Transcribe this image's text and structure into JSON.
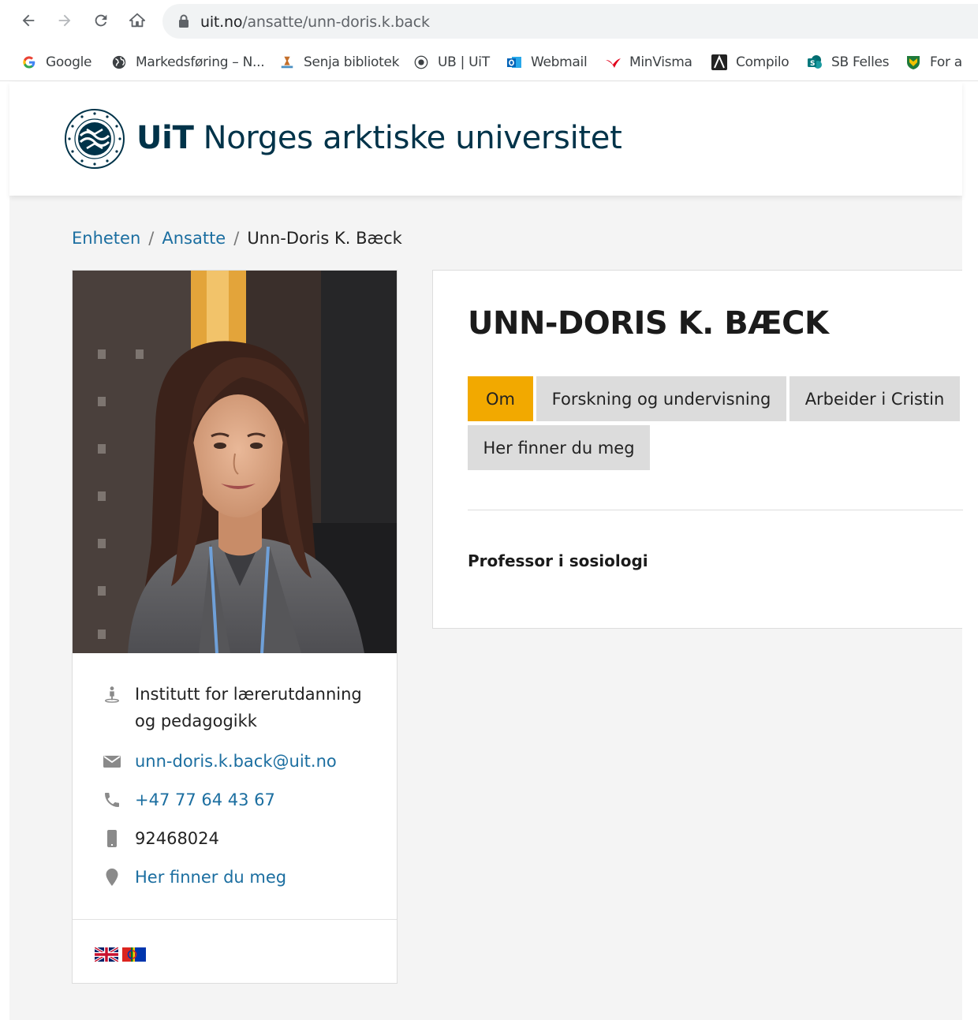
{
  "browser": {
    "url_host": "uit.no",
    "url_path": "/ansatte/unn-doris.k.back",
    "bookmarks": [
      {
        "label": "Google",
        "icon": "google-icon"
      },
      {
        "label": "Markedsføring – N...",
        "icon": "globe-icon"
      },
      {
        "label": "Senja bibliotek",
        "icon": "library-icon"
      },
      {
        "label": "UB | UiT",
        "icon": "uit-seal-icon"
      },
      {
        "label": "Webmail",
        "icon": "outlook-icon"
      },
      {
        "label": "MinVisma",
        "icon": "visma-icon"
      },
      {
        "label": "Compilo",
        "icon": "compilo-icon"
      },
      {
        "label": "SB Felles",
        "icon": "sharepoint-icon"
      },
      {
        "label": "For a",
        "icon": "shield-icon"
      }
    ]
  },
  "site": {
    "logo_short": "UiT",
    "logo_name": "Norges arktiske universitet"
  },
  "breadcrumb": {
    "items": [
      "Enheten",
      "Ansatte"
    ],
    "current": "Unn-Doris K. Bæck",
    "separator": "/"
  },
  "profile": {
    "name": "UNN-DORIS K. BÆCK",
    "job_title": "Professor i sosiologi",
    "department": "Institutt for lærerutdanning og pedagogikk",
    "email": "unn-doris.k.back@uit.no",
    "phone": "+47 77 64 43 67",
    "mobile": "92468024",
    "location_link": "Her finner du meg"
  },
  "tabs": [
    {
      "label": "Om",
      "active": true
    },
    {
      "label": "Forskning og undervisning",
      "active": false
    },
    {
      "label": "Arbeider i Cristin",
      "active": false
    },
    {
      "label": "Her finner du meg",
      "active": false
    }
  ],
  "languages": [
    "english-flag-icon",
    "sami-flag-icon"
  ],
  "colors": {
    "accent": "#f2a900",
    "link": "#1b6ea0",
    "brand": "#003349",
    "tab_bg": "#dcdcdc"
  }
}
